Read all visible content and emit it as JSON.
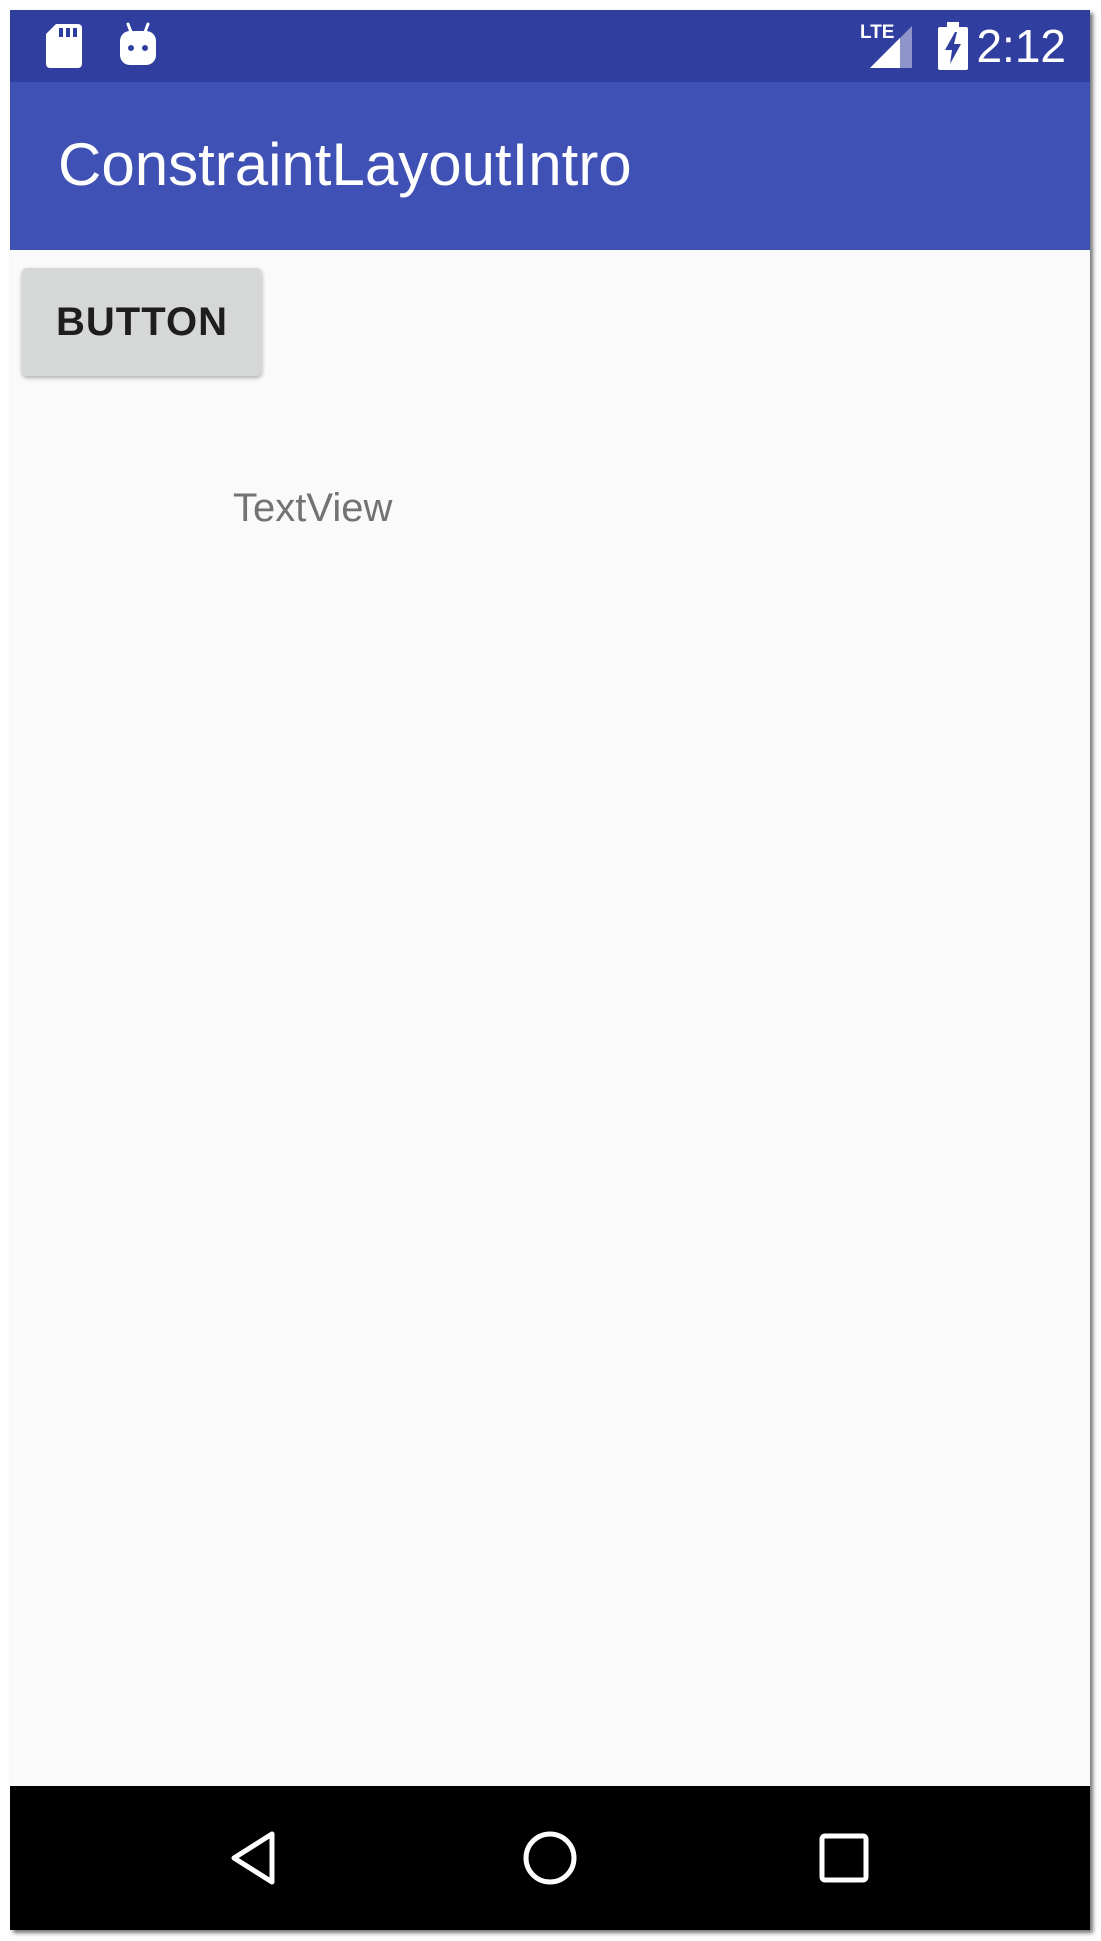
{
  "status_bar": {
    "icons": [
      "sd-card-icon",
      "android-icon",
      "lte-signal-icon",
      "battery-charging-icon"
    ],
    "network_label": "LTE",
    "time": "2:12"
  },
  "app_bar": {
    "title": "ConstraintLayoutIntro"
  },
  "content": {
    "button_label": "BUTTON",
    "text_view": "TextView"
  },
  "nav_bar": {
    "icons": [
      "back-icon",
      "home-icon",
      "recents-icon"
    ]
  },
  "colors": {
    "status_bar": "#303f9f",
    "app_bar": "#3f51b5",
    "background": "#fafafa",
    "button": "#d6d7d7",
    "nav_bar": "#000000"
  }
}
